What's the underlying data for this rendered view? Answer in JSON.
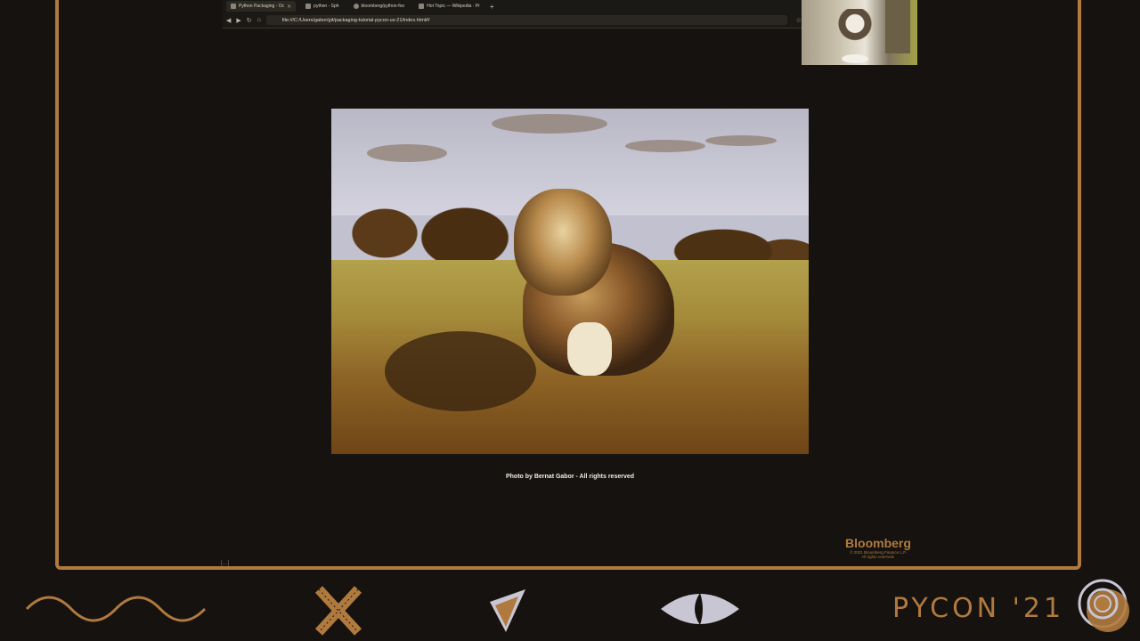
{
  "browser": {
    "tabs": [
      {
        "title": "Python Packaging - Oc",
        "active": true
      },
      {
        "title": "python - Sph"
      },
      {
        "title": "bloomberg/python-foo"
      },
      {
        "title": "Hot Topic — Wikipedia · Pr"
      }
    ],
    "url": "file:///C:/Users/gabor/git/packaging-tutorial-pycon-us-21/index.html#/"
  },
  "slide": {
    "caption": "Photo by Bernat Gabor - All rights reserved"
  },
  "sponsor": {
    "name": "Bloomberg",
    "fine_print_1": "© 2021 Bloomberg Finance L.P.",
    "fine_print_2": "All rights reserved."
  },
  "status_snippet": "[…]",
  "footer": {
    "brand": "PYCON '21"
  },
  "colors": {
    "accent": "#b07a3e",
    "background": "#15120f",
    "icon_light": "#c8c6d2"
  },
  "icons": [
    "wave-icon",
    "cross-icon",
    "triangle-arrow-icon",
    "eye-icon",
    "target-icon"
  ]
}
